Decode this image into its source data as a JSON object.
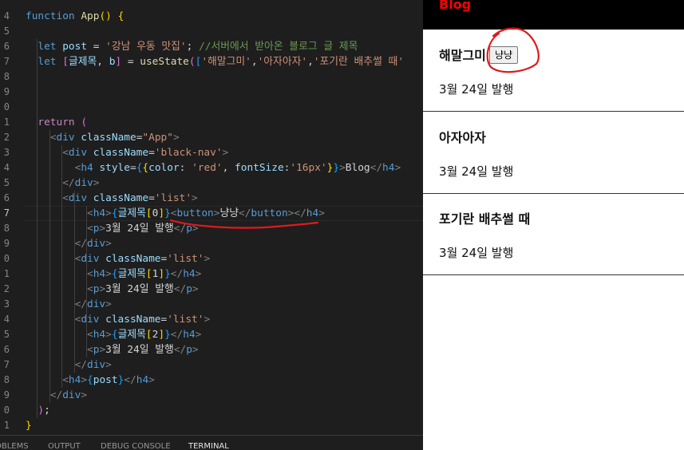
{
  "editor": {
    "line_numbers": [
      "4",
      "5",
      "6",
      "7",
      "8",
      "9",
      "0",
      "1",
      "2",
      "3",
      "4",
      "5",
      "6",
      "7",
      "8",
      "9",
      "0",
      "1",
      "2",
      "3",
      "4",
      "5",
      "6",
      "7",
      "8",
      "9",
      "0",
      "1"
    ],
    "active_line_number": "8",
    "lines": [
      [
        [
          "kw",
          "function "
        ],
        [
          "fn",
          "App"
        ],
        [
          "brc",
          "()"
        ],
        [
          "txt",
          " "
        ],
        [
          "brc",
          "{"
        ]
      ],
      [],
      [
        [
          "kw",
          "let "
        ],
        [
          "var",
          "post"
        ],
        [
          "txt",
          " = "
        ],
        [
          "str",
          "'강남 우동 맛집'"
        ],
        [
          "txt",
          "; "
        ],
        [
          "cmt",
          "//서버에서 받아온 블로그 글 제목"
        ]
      ],
      [
        [
          "kw",
          "let "
        ],
        [
          "brc2",
          "["
        ],
        [
          "var",
          "글제목"
        ],
        [
          "txt",
          ", "
        ],
        [
          "var",
          "b"
        ],
        [
          "brc2",
          "]"
        ],
        [
          "txt",
          " = "
        ],
        [
          "fn",
          "useState"
        ],
        [
          "brc2",
          "("
        ],
        [
          "brc3",
          "["
        ],
        [
          "str",
          "'해말그미'"
        ],
        [
          "txt",
          ","
        ],
        [
          "str",
          "'아자아자'"
        ],
        [
          "txt",
          ","
        ],
        [
          "str",
          "'포기란 배추썰 때'"
        ]
      ],
      [],
      [],
      [],
      [
        [
          "ctl",
          "return "
        ],
        [
          "brc2",
          "("
        ]
      ],
      [
        [
          "punc",
          "<"
        ],
        [
          "tag",
          "div "
        ],
        [
          "var",
          "className"
        ],
        [
          "txt",
          "="
        ],
        [
          "str",
          "\"App\""
        ],
        [
          "punc",
          ">"
        ]
      ],
      [
        [
          "punc",
          "<"
        ],
        [
          "tag",
          "div "
        ],
        [
          "var",
          "className"
        ],
        [
          "txt",
          "="
        ],
        [
          "str",
          "'black-nav'"
        ],
        [
          "punc",
          ">"
        ]
      ],
      [
        [
          "punc",
          "<"
        ],
        [
          "tag",
          "h4 "
        ],
        [
          "var",
          "style"
        ],
        [
          "txt",
          "="
        ],
        [
          "brc3",
          "{"
        ],
        [
          "brc",
          "{"
        ],
        [
          "var",
          "color"
        ],
        [
          "txt",
          ": "
        ],
        [
          "str",
          "'red'"
        ],
        [
          "txt",
          ", "
        ],
        [
          "var",
          "fontSize"
        ],
        [
          "txt",
          ":"
        ],
        [
          "str",
          "'16px'"
        ],
        [
          "brc",
          "}"
        ],
        [
          "brc3",
          "}"
        ],
        [
          "punc",
          ">"
        ],
        [
          "txt",
          "Blog"
        ],
        [
          "punc",
          "</"
        ],
        [
          "tag",
          "h4"
        ],
        [
          "punc",
          ">"
        ]
      ],
      [
        [
          "punc",
          "</"
        ],
        [
          "tag",
          "div"
        ],
        [
          "punc",
          ">"
        ]
      ],
      [
        [
          "punc",
          "<"
        ],
        [
          "tag",
          "div "
        ],
        [
          "var",
          "className"
        ],
        [
          "txt",
          "="
        ],
        [
          "str",
          "'list'"
        ],
        [
          "punc",
          ">"
        ]
      ],
      [
        [
          "punc",
          "<"
        ],
        [
          "tag",
          "h4"
        ],
        [
          "punc",
          ">"
        ],
        [
          "brc3",
          "{"
        ],
        [
          "var",
          "글제목"
        ],
        [
          "brc",
          "["
        ],
        [
          "txt",
          "0"
        ],
        [
          "brc",
          "]"
        ],
        [
          "brc3",
          "}"
        ],
        [
          "punc",
          "<"
        ],
        [
          "tag",
          "button"
        ],
        [
          "punc",
          ">"
        ],
        [
          "txt",
          "냥냥"
        ],
        [
          "punc",
          "</"
        ],
        [
          "tag",
          "button"
        ],
        [
          "punc",
          "></"
        ],
        [
          "tag",
          "h4"
        ],
        [
          "punc",
          ">"
        ]
      ],
      [
        [
          "punc",
          "<"
        ],
        [
          "tag",
          "p"
        ],
        [
          "punc",
          ">"
        ],
        [
          "txt",
          "3월 24일 발행"
        ],
        [
          "punc",
          "</"
        ],
        [
          "tag",
          "p"
        ],
        [
          "punc",
          ">"
        ]
      ],
      [
        [
          "punc",
          "</"
        ],
        [
          "tag",
          "div"
        ],
        [
          "punc",
          ">"
        ]
      ],
      [
        [
          "punc",
          "<"
        ],
        [
          "tag",
          "div "
        ],
        [
          "var",
          "className"
        ],
        [
          "txt",
          "="
        ],
        [
          "str",
          "'list'"
        ],
        [
          "punc",
          ">"
        ]
      ],
      [
        [
          "punc",
          "<"
        ],
        [
          "tag",
          "h4"
        ],
        [
          "punc",
          ">"
        ],
        [
          "brc3",
          "{"
        ],
        [
          "var",
          "글제목"
        ],
        [
          "brc",
          "["
        ],
        [
          "txt",
          "1"
        ],
        [
          "brc",
          "]"
        ],
        [
          "brc3",
          "}"
        ],
        [
          "punc",
          "</"
        ],
        [
          "tag",
          "h4"
        ],
        [
          "punc",
          ">"
        ]
      ],
      [
        [
          "punc",
          "<"
        ],
        [
          "tag",
          "p"
        ],
        [
          "punc",
          ">"
        ],
        [
          "txt",
          "3월 24일 발행"
        ],
        [
          "punc",
          "</"
        ],
        [
          "tag",
          "p"
        ],
        [
          "punc",
          ">"
        ]
      ],
      [
        [
          "punc",
          "</"
        ],
        [
          "tag",
          "div"
        ],
        [
          "punc",
          ">"
        ]
      ],
      [
        [
          "punc",
          "<"
        ],
        [
          "tag",
          "div "
        ],
        [
          "var",
          "className"
        ],
        [
          "txt",
          "="
        ],
        [
          "str",
          "'list'"
        ],
        [
          "punc",
          ">"
        ]
      ],
      [
        [
          "punc",
          "<"
        ],
        [
          "tag",
          "h4"
        ],
        [
          "punc",
          ">"
        ],
        [
          "brc3",
          "{"
        ],
        [
          "var",
          "글제목"
        ],
        [
          "brc",
          "["
        ],
        [
          "txt",
          "2"
        ],
        [
          "brc",
          "]"
        ],
        [
          "brc3",
          "}"
        ],
        [
          "punc",
          "</"
        ],
        [
          "tag",
          "h4"
        ],
        [
          "punc",
          ">"
        ]
      ],
      [
        [
          "punc",
          "<"
        ],
        [
          "tag",
          "p"
        ],
        [
          "punc",
          ">"
        ],
        [
          "txt",
          "3월 24일 발행"
        ],
        [
          "punc",
          "</"
        ],
        [
          "tag",
          "p"
        ],
        [
          "punc",
          ">"
        ]
      ],
      [
        [
          "punc",
          "</"
        ],
        [
          "tag",
          "div"
        ],
        [
          "punc",
          ">"
        ]
      ],
      [
        [
          "punc",
          "<"
        ],
        [
          "tag",
          "h4"
        ],
        [
          "punc",
          ">"
        ],
        [
          "brc3",
          "{"
        ],
        [
          "var",
          "post"
        ],
        [
          "brc3",
          "}"
        ],
        [
          "punc",
          "</"
        ],
        [
          "tag",
          "h4"
        ],
        [
          "punc",
          ">"
        ]
      ],
      [
        [
          "punc",
          "</"
        ],
        [
          "tag",
          "div"
        ],
        [
          "punc",
          ">"
        ]
      ],
      [
        [
          "brc2",
          ")"
        ],
        [
          "txt",
          ";"
        ]
      ],
      [
        [
          "brc",
          "}"
        ]
      ]
    ],
    "panel_tabs": [
      "OBLEMS",
      "OUTPUT",
      "DEBUG CONSOLE",
      "TERMINAL"
    ],
    "active_panel_tab": "TERMINAL"
  },
  "preview": {
    "nav_title": "Blog",
    "nav_title_color": "#ff0000",
    "posts": [
      {
        "title": "해말그미",
        "button": "냥냥",
        "date": "3월 24일 발행"
      },
      {
        "title": "아자아자",
        "date": "3월 24일 발행"
      },
      {
        "title": "포기란 배추썰 때",
        "date": "3월 24일 발행"
      }
    ]
  },
  "annotation_color": "#e0191e"
}
